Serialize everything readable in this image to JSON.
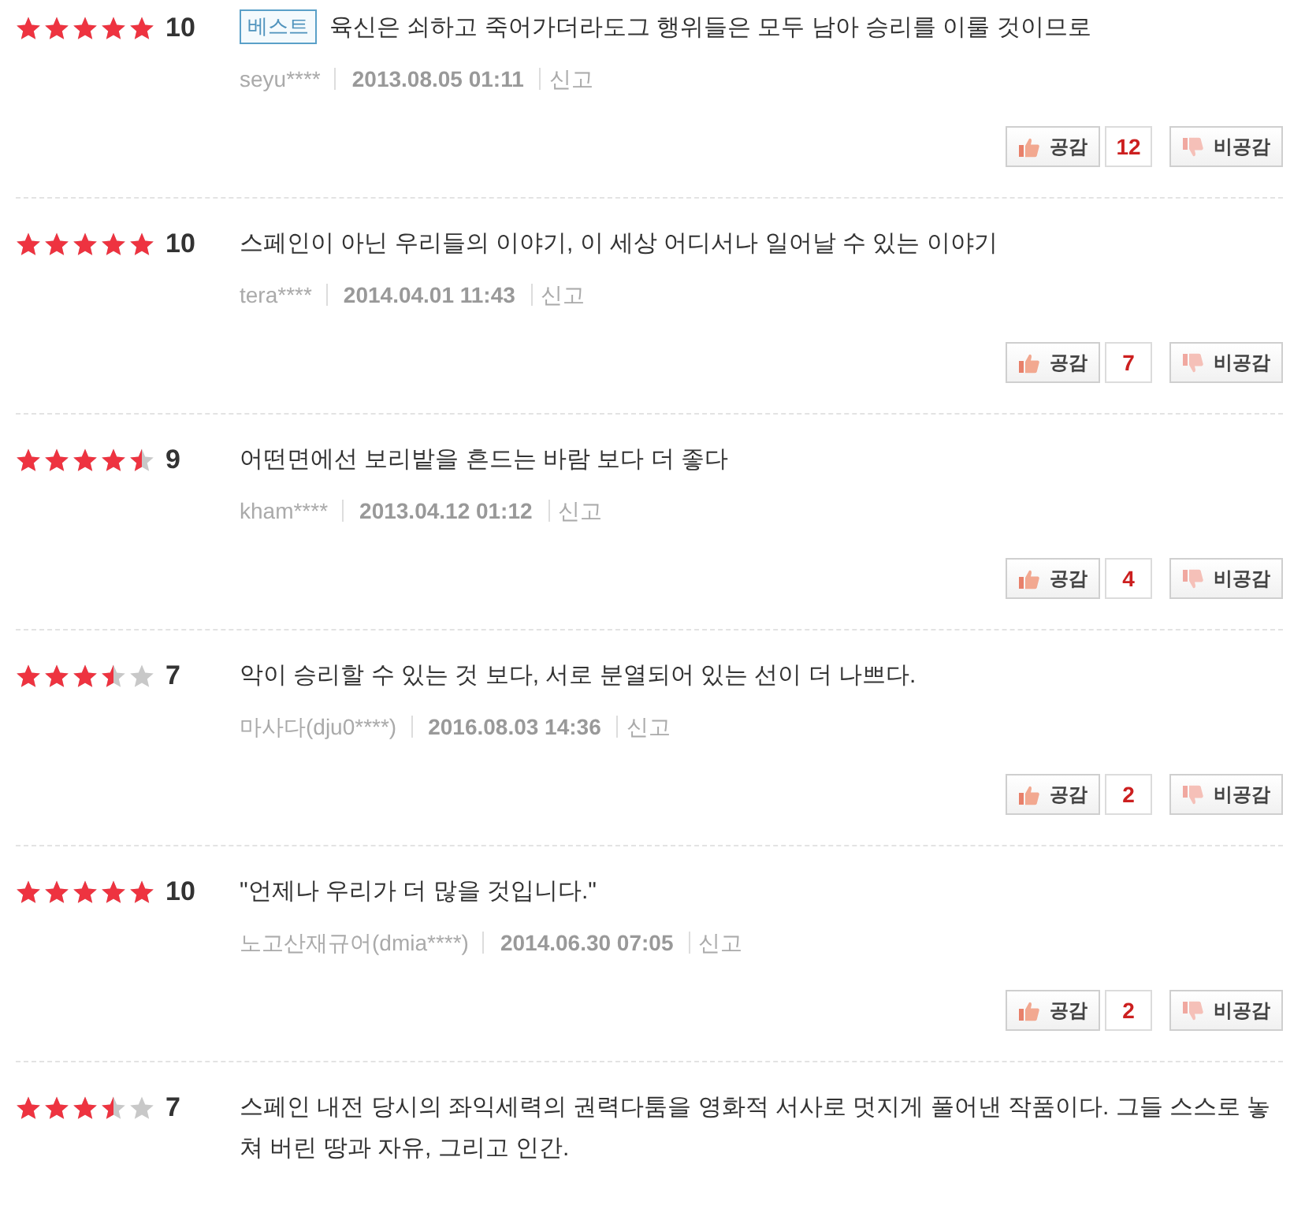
{
  "reviews": [
    {
      "stars": 5,
      "score": "10",
      "badge": "베스트",
      "text": "육신은 쇠하고 죽어가더라도그 행위들은 모두 남아 승리를 이룰 것이므로",
      "author": "seyu****",
      "date": "2013.08.05 01:11",
      "report": "신고",
      "like_label": "공감",
      "like_count": "12",
      "dislike_label": "비공감"
    },
    {
      "stars": 5,
      "score": "10",
      "text": "스페인이 아닌 우리들의 이야기, 이 세상 어디서나 일어날 수 있는 이야기",
      "author": "tera****",
      "date": "2014.04.01 11:43",
      "report": "신고",
      "like_label": "공감",
      "like_count": "7",
      "dislike_label": "비공감"
    },
    {
      "stars": 4.5,
      "score": "9",
      "text": "어떤면에선 보리밭을 흔드는 바람 보다 더 좋다",
      "author": "kham****",
      "date": "2013.04.12 01:12",
      "report": "신고",
      "like_label": "공감",
      "like_count": "4",
      "dislike_label": "비공감"
    },
    {
      "stars": 3.5,
      "score": "7",
      "text": "악이 승리할 수 있는 것 보다, 서로 분열되어 있는 선이 더 나쁘다.",
      "author": "마사다(dju0****)",
      "date": "2016.08.03 14:36",
      "report": "신고",
      "like_label": "공감",
      "like_count": "2",
      "dislike_label": "비공감"
    },
    {
      "stars": 5,
      "score": "10",
      "text": "\"언제나 우리가 더 많을 것입니다.\"",
      "author": "노고산재규어(dmia****)",
      "date": "2014.06.30 07:05",
      "report": "신고",
      "like_label": "공감",
      "like_count": "2",
      "dislike_label": "비공감"
    },
    {
      "stars": 3.5,
      "score": "7",
      "text": "스페인 내전 당시의 좌익세력의 권력다툼을 영화적 서사로 멋지게 풀어낸 작품이다. 그들 스스로 놓쳐 버린 땅과 자유, 그리고 인간."
    }
  ]
}
